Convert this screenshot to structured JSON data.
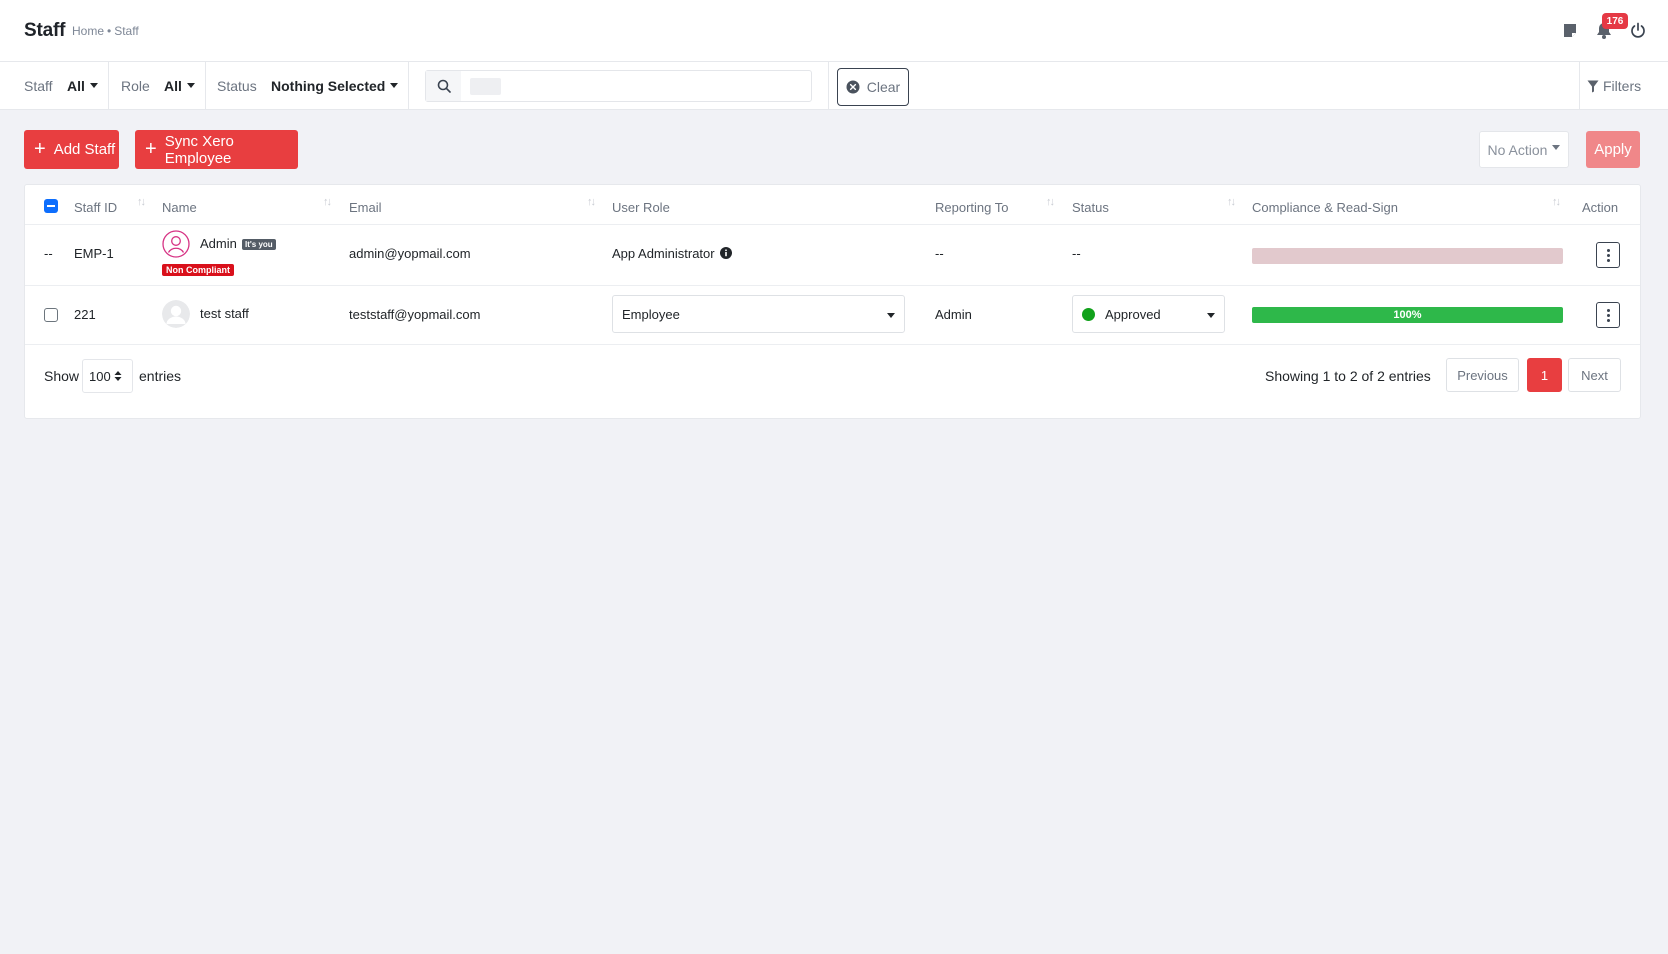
{
  "header": {
    "title": "Staff",
    "breadcrumb": [
      "Home",
      "Staff"
    ],
    "breadcrumb_sep": "•",
    "notification_count": "176"
  },
  "filters": {
    "staff_label": "Staff",
    "staff_value": "All",
    "role_label": "Role",
    "role_value": "All",
    "status_label": "Status",
    "status_value": "Nothing Selected",
    "search_value": "",
    "clear_label": "Clear",
    "filters_label": "Filters"
  },
  "actions": {
    "add_staff_label": "Add Staff",
    "sync_label": "Sync Xero Employee",
    "bulk_action_value": "No Action",
    "apply_label": "Apply"
  },
  "table": {
    "columns": [
      "Staff ID",
      "Name",
      "Email",
      "User Role",
      "Reporting To",
      "Status",
      "Compliance & Read-Sign",
      "Action"
    ],
    "rows": [
      {
        "checkbox": "--",
        "staff_id": "EMP-1",
        "name": "Admin",
        "you_tag": "It's you",
        "compliance_tag": "Non Compliant",
        "email": "admin@yopmail.com",
        "role": "App Administrator",
        "reporting_to": "--",
        "status": "--",
        "progress": 0
      },
      {
        "staff_id": "221",
        "name": "test staff",
        "email": "teststaff@yopmail.com",
        "role": "Employee",
        "reporting_to": "Admin",
        "status": "Approved",
        "progress": 100,
        "progress_label": "100%"
      }
    ]
  },
  "footer": {
    "show_label": "Show",
    "page_length": "100",
    "entries_label": "entries",
    "info": "Showing 1 to 2 of 2 entries",
    "previous_label": "Previous",
    "current_page": "1",
    "next_label": "Next"
  },
  "colors": {
    "brand_red": "#e83e40",
    "approved_green": "#11a11b",
    "progress_green": "#2eb84a"
  }
}
